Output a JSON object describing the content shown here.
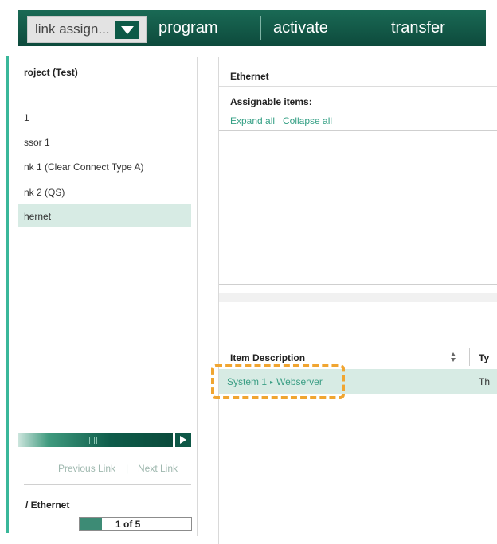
{
  "toolbar": {
    "dropdown_value": "link assign...",
    "dropdown_icon": "triangle-down-icon",
    "menu": [
      "program",
      "activate",
      "transfer"
    ],
    "colors": {
      "band": "#0d4a3c",
      "accent": "#39b79a",
      "highlight": "#f0a531"
    }
  },
  "left_panel": {
    "title": "roject (Test)",
    "items": [
      "1",
      "ssor 1",
      "nk 1 (Clear Connect Type A)",
      "nk 2 (QS)",
      "hernet"
    ],
    "selected_index": 4,
    "prev_link": "Previous Link",
    "separator": "|",
    "next_link": "Next Link",
    "bottom_title": "/ Ethernet",
    "pager_text": "1 of 5",
    "pager_progress": 0.2
  },
  "right_panel": {
    "title": "Ethernet",
    "assignable_label": "Assignable items:",
    "expand_all": "Expand all",
    "collapse_all": "Collapse all",
    "columns": [
      "Item Description",
      "Ty"
    ],
    "rows": [
      {
        "system": "System 1",
        "caret": "▸",
        "item": "Webserver",
        "type": "Th"
      }
    ]
  }
}
